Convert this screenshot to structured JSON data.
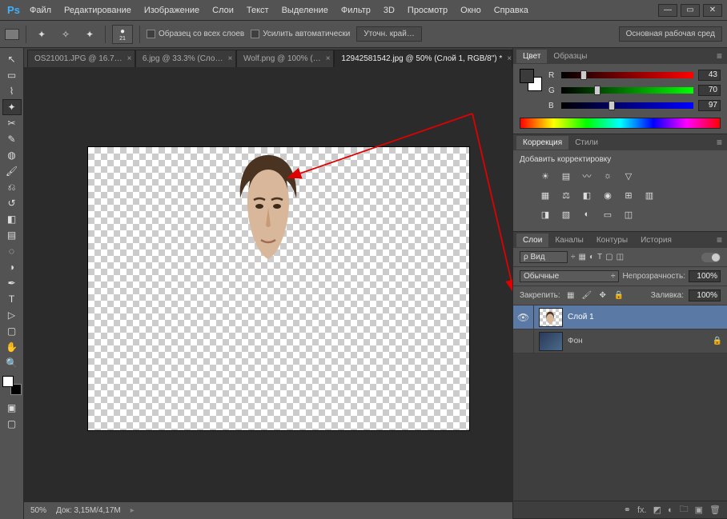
{
  "app": {
    "name": "Ps"
  },
  "menu": {
    "items": [
      "Файл",
      "Редактирование",
      "Изображение",
      "Слои",
      "Текст",
      "Выделение",
      "Фильтр",
      "3D",
      "Просмотр",
      "Окно",
      "Справка"
    ]
  },
  "options": {
    "brush_size": "21",
    "sample_all_layers": "Образец со всех слоев",
    "auto_enhance": "Усилить автоматически",
    "refine_edge": "Уточн. край…",
    "workspace_button": "Основная рабочая сред"
  },
  "tabs": [
    {
      "label": "OS21001.JPG @ 16.7…"
    },
    {
      "label": "6.jpg @ 33.3% (Сло…"
    },
    {
      "label": "Wolf.png @ 100% (…"
    },
    {
      "label": "12942581542.jpg @ 50% (Слой 1, RGB/8\") *",
      "active": true
    }
  ],
  "status": {
    "zoom": "50%",
    "doc": "Док: 3,15M/4,17M"
  },
  "color_panel": {
    "tabs": [
      "Цвет",
      "Образцы"
    ],
    "channels": {
      "r": {
        "label": "R",
        "value": "43",
        "pct": 17
      },
      "g": {
        "label": "G",
        "value": "70",
        "pct": 27
      },
      "b": {
        "label": "B",
        "value": "97",
        "pct": 38
      }
    }
  },
  "adjustments_panel": {
    "tabs": [
      "Коррекция",
      "Стили"
    ],
    "title": "Добавить корректировку"
  },
  "layers_panel": {
    "tabs": [
      "Слои",
      "Каналы",
      "Контуры",
      "История"
    ],
    "filter_label": "ρ Вид",
    "blend_mode": "Обычные",
    "opacity_label": "Непрозрачность:",
    "opacity_value": "100%",
    "lock_label": "Закрепить:",
    "fill_label": "Заливка:",
    "fill_value": "100%",
    "layers": [
      {
        "name": "Слой 1",
        "visible": true,
        "selected": true,
        "thumb": "checker"
      },
      {
        "name": "Фон",
        "visible": false,
        "selected": false,
        "locked": true,
        "thumb": "photo"
      }
    ]
  },
  "tool_names": [
    "move-tool",
    "rectangular-marquee-tool",
    "lasso-tool",
    "quick-selection-tool",
    "crop-tool",
    "eyedropper-tool",
    "spot-healing-tool",
    "brush-tool",
    "clone-stamp-tool",
    "history-brush-tool",
    "eraser-tool",
    "gradient-tool",
    "blur-tool",
    "dodge-tool",
    "pen-tool",
    "type-tool",
    "path-selection-tool",
    "rectangle-tool",
    "hand-tool",
    "zoom-tool"
  ]
}
